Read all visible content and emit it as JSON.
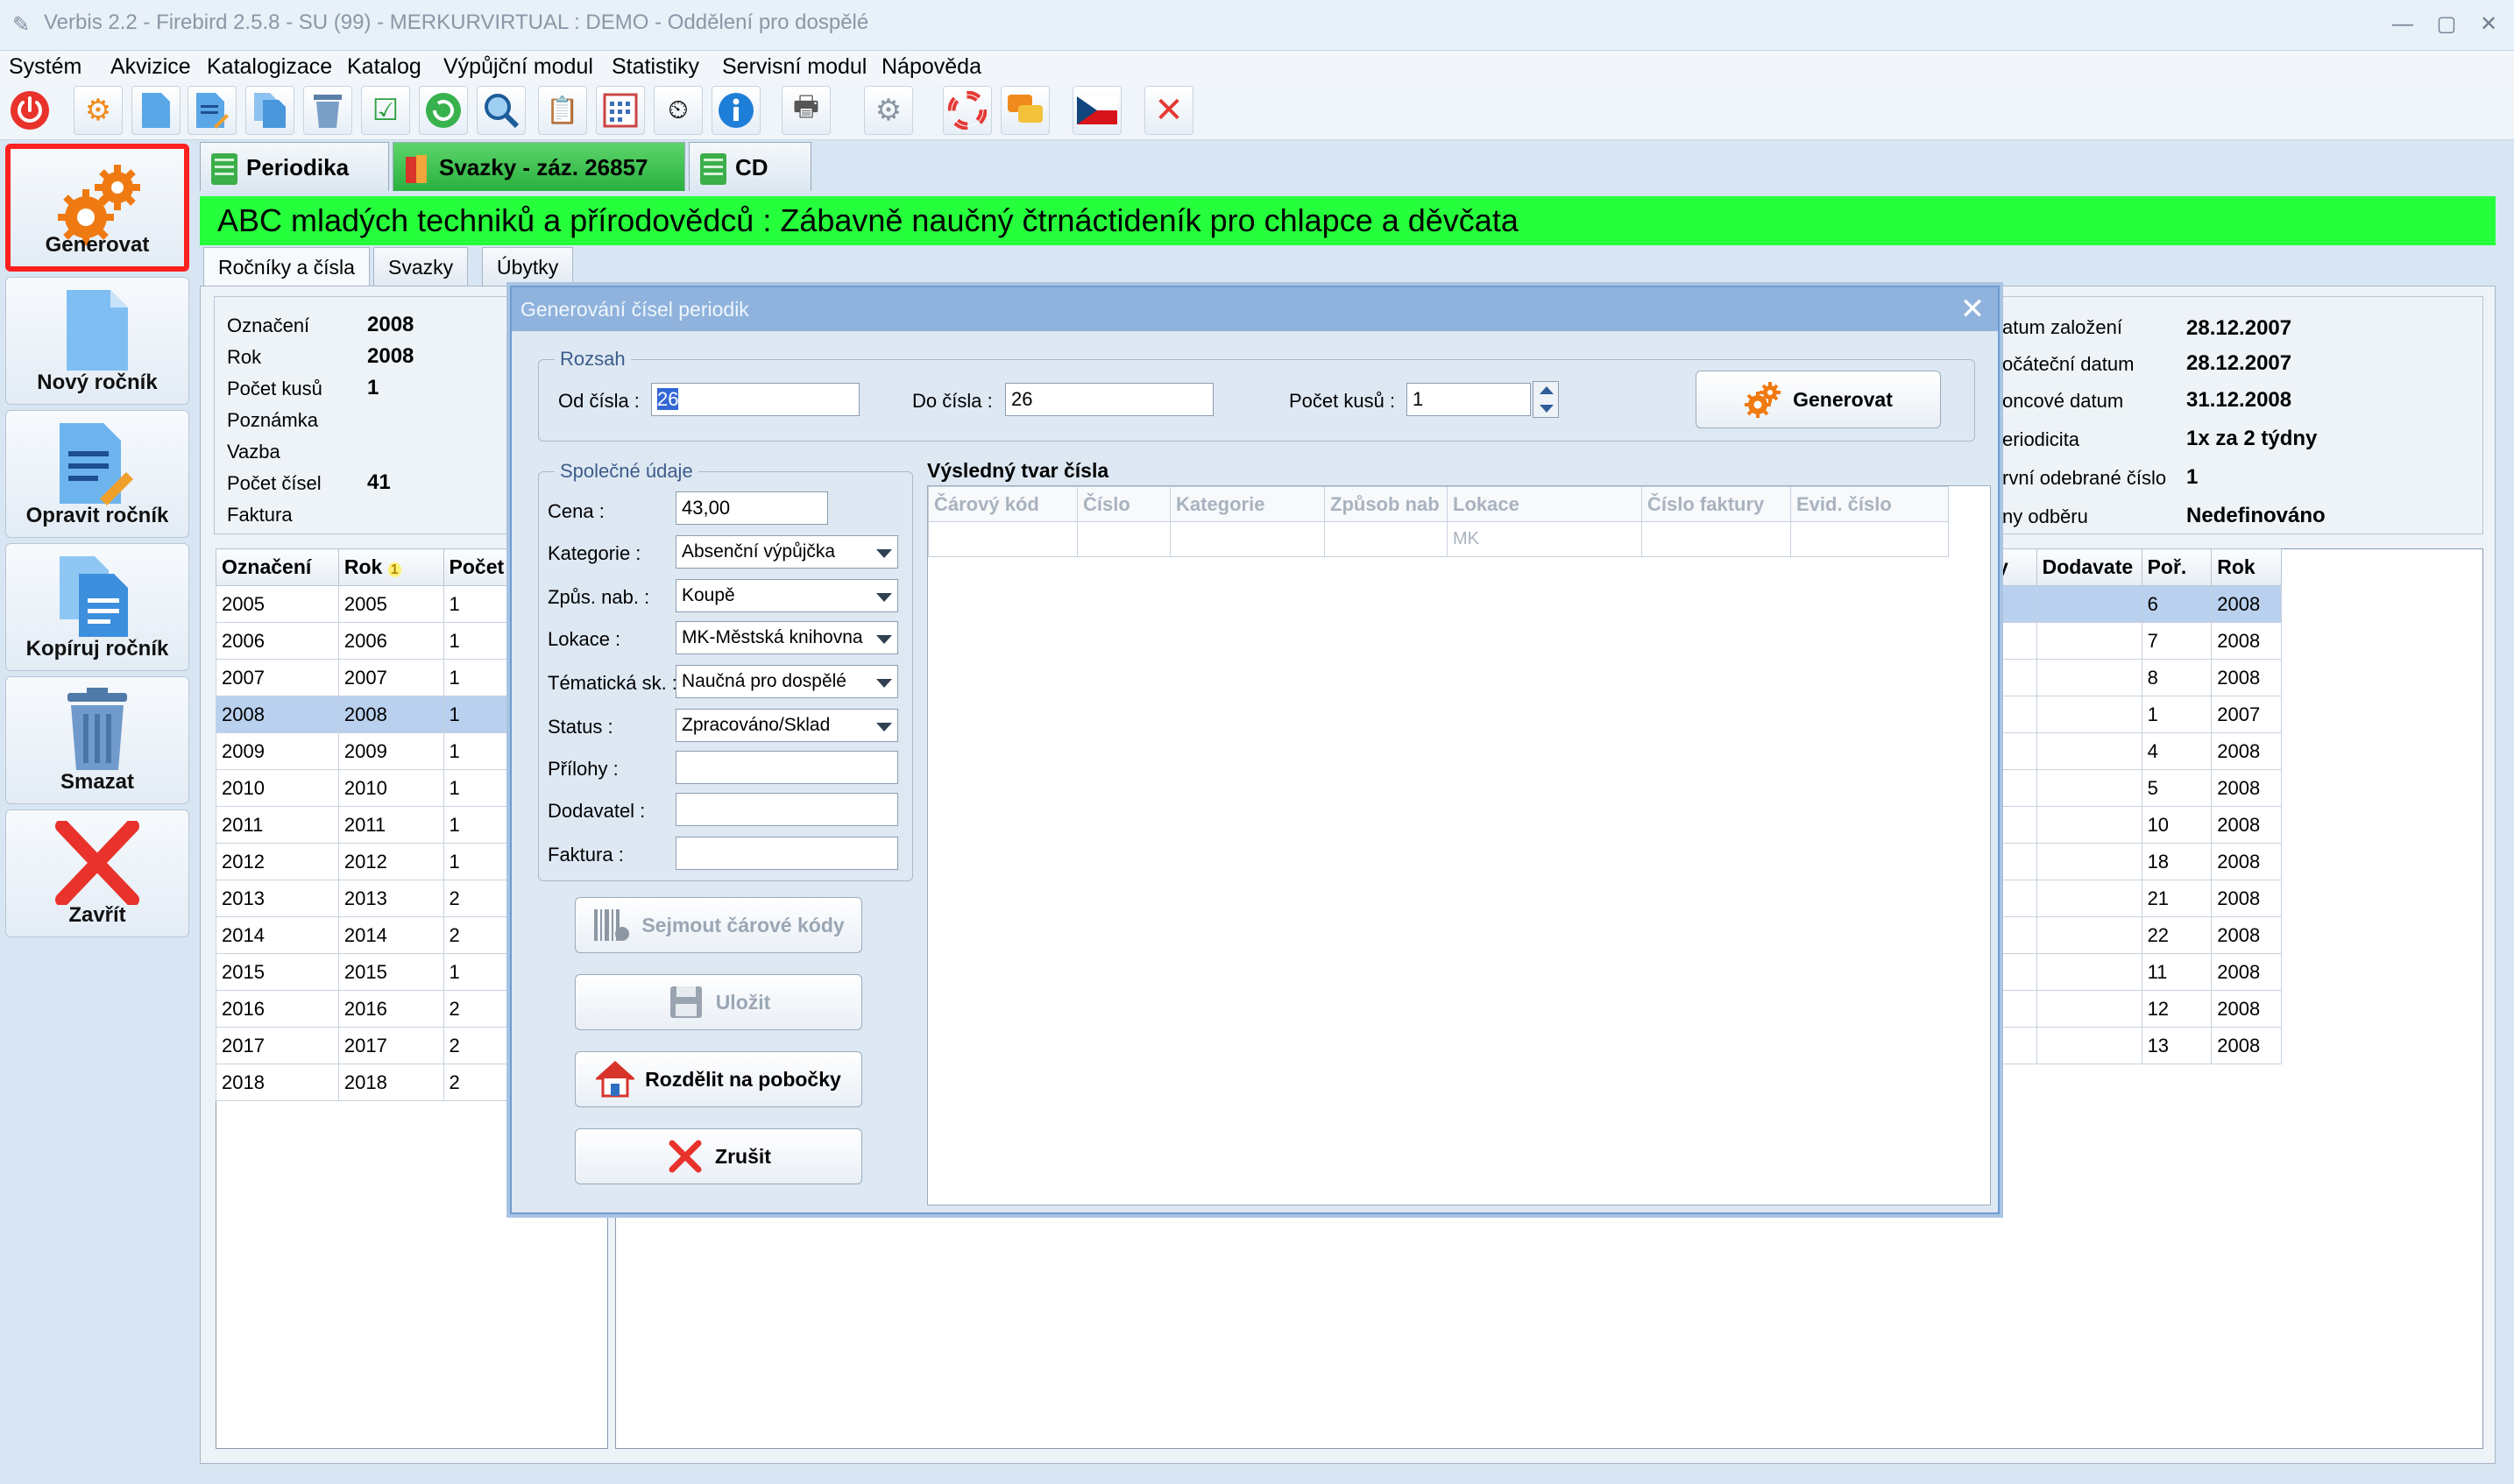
{
  "window": {
    "title": "Verbis 2.2 - Firebird 2.5.8 - SU (99) - MERKURVIRTUAL : DEMO - Oddělení pro dospělé"
  },
  "menu": [
    "Systém",
    "Akvizice",
    "Katalogizace",
    "Katalog",
    "Výpůjční modul",
    "Statistiky",
    "Servisní modul",
    "Nápověda"
  ],
  "sidebar": {
    "generate": "Generovat",
    "new_year": "Nový ročník",
    "edit_year": "Opravit ročník",
    "copy_year": "Kopíruj ročník",
    "delete": "Smazat",
    "close": "Zavřít"
  },
  "doc_tabs": [
    "Periodika",
    "Svazky - záz. 26857",
    "CD"
  ],
  "record_title": "ABC mladých techniků a přírodovědců : Zábavně naučný čtrnáctideník pro chlapce a děvčata",
  "sub_tabs": [
    "Ročníky a čísla",
    "Svazky",
    "Úbytky"
  ],
  "year_info": {
    "labels": [
      "Označení",
      "Rok",
      "Počet kusů",
      "Poznámka",
      "Vazba",
      "Počet čísel",
      "Faktura"
    ],
    "values": [
      "2008",
      "2008",
      "1",
      "",
      "",
      "41",
      ""
    ]
  },
  "right_info": {
    "labels": [
      "atum založení",
      "očáteční datum",
      "oncové datum",
      "eriodicita",
      "rvní odebrané číslo",
      "ny odběru"
    ],
    "values": [
      "28.12.2007",
      "28.12.2007",
      "31.12.2008",
      "1x za 2 týdny",
      "1",
      "Nedefinováno"
    ]
  },
  "years_table": {
    "headers": [
      "Označení",
      "Rok",
      "Počet"
    ],
    "sort_marker": "1",
    "rows": [
      [
        "2005",
        "2005",
        "1"
      ],
      [
        "2006",
        "2006",
        "1"
      ],
      [
        "2007",
        "2007",
        "1"
      ],
      [
        "2008",
        "2008",
        "1"
      ],
      [
        "2009",
        "2009",
        "1"
      ],
      [
        "2010",
        "2010",
        "1"
      ],
      [
        "2011",
        "2011",
        "1"
      ],
      [
        "2012",
        "2012",
        "1"
      ],
      [
        "2013",
        "2013",
        "2"
      ],
      [
        "2014",
        "2014",
        "2"
      ],
      [
        "2015",
        "2015",
        "1"
      ],
      [
        "2016",
        "2016",
        "2"
      ],
      [
        "2017",
        "2017",
        "2"
      ],
      [
        "2018",
        "2018",
        "2"
      ]
    ]
  },
  "issues_table": {
    "headers": [
      "y",
      "Dodavate",
      "Poř.",
      "Rok"
    ],
    "rows": [
      [
        "6",
        "2008"
      ],
      [
        "7",
        "2008"
      ],
      [
        "8",
        "2008"
      ],
      [
        "1",
        "2007"
      ],
      [
        "4",
        "2008"
      ],
      [
        "5",
        "2008"
      ],
      [
        "10",
        "2008"
      ],
      [
        "18",
        "2008"
      ],
      [
        "21",
        "2008"
      ],
      [
        "22",
        "2008"
      ],
      [
        "11",
        "2008"
      ],
      [
        "12",
        "2008"
      ],
      [
        "13",
        "2008"
      ]
    ]
  },
  "dialog": {
    "title": "Generování čísel periodik",
    "range_group": "Rozsah",
    "from_label": "Od čísla :",
    "from_value": "26",
    "to_label": "Do čísla :",
    "to_value": "26",
    "count_label": "Počet kusů :",
    "count_value": "1",
    "generate_button": "Generovat",
    "common_group": "Společné údaje",
    "fields": [
      {
        "label": "Cena :",
        "value": "43,00"
      },
      {
        "label": "Kategorie :",
        "value": "Absenční výpůjčka"
      },
      {
        "label": "Způs. nab. :",
        "value": "Koupě"
      },
      {
        "label": "Lokace :",
        "value": "MK-Městská knihovna"
      },
      {
        "label": "Tématická sk. :",
        "value": "Naučná pro dospělé"
      },
      {
        "label": "Status :",
        "value": "Zpracováno/Sklad"
      },
      {
        "label": "Přílohy :",
        "value": ""
      },
      {
        "label": "Dodavatel :",
        "value": ""
      },
      {
        "label": "Faktura :",
        "value": ""
      }
    ],
    "scan_button": "Sejmout čárové kódy",
    "save_button": "Uložit",
    "split_button": "Rozdělit na pobočky",
    "cancel_button": "Zrušit",
    "result_label": "Výsledný tvar čísla",
    "result_headers": [
      "Čárový kód",
      "Číslo",
      "Kategorie",
      "Způsob nab",
      "Lokace",
      "Číslo faktury",
      "Evid. číslo"
    ],
    "result_row": [
      "",
      "",
      "",
      "",
      "MK",
      "",
      ""
    ]
  }
}
